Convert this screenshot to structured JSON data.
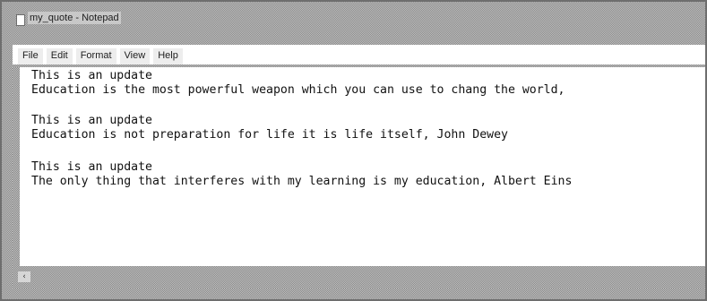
{
  "window": {
    "title": "my_quote - Notepad"
  },
  "menubar": {
    "items": [
      {
        "label": "File"
      },
      {
        "label": "Edit"
      },
      {
        "label": "Format"
      },
      {
        "label": "View"
      },
      {
        "label": "Help"
      }
    ]
  },
  "editor": {
    "lines": [
      "This is an update",
      "Education is the most powerful weapon which you can use to chang the world, ",
      "",
      "This is an update",
      "Education is not preparation for life it is life itself, John Dewey",
      "",
      "This is an update",
      "The only thing that interferes with my learning is my education, Albert Eins"
    ]
  },
  "scrollbar": {
    "left_arrow": "‹"
  },
  "icons": {
    "app": "notepad-icon",
    "scroll_left": "chevron-left-icon"
  }
}
